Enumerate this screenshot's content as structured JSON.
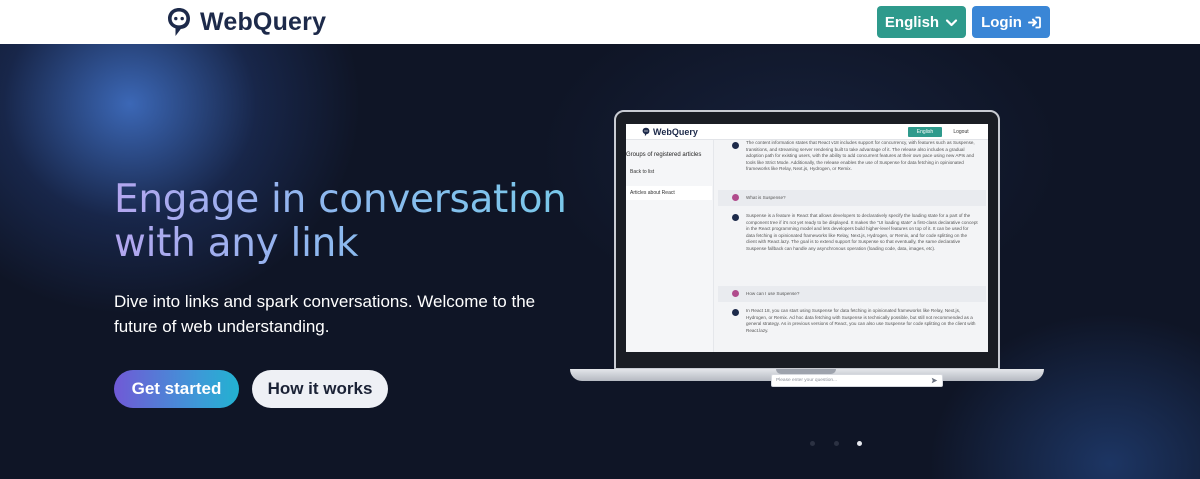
{
  "header": {
    "brand_name": "WebQuery",
    "language_label": "English",
    "login_label": "Login"
  },
  "hero": {
    "title_line1": "Engage in conversation",
    "title_line2": "with any link",
    "subtitle": "Dive into links and spark conversations. Welcome to the future of web understanding.",
    "cta_label": "Get started",
    "secondary_label": "How it works"
  },
  "screen": {
    "brand_name": "WebQuery",
    "language_label": "English",
    "logout_label": "Logout",
    "sidebar_title": "Groups of registered articles",
    "back_link": "Back to list",
    "selected_group": "Articles about React",
    "input_placeholder": "Please enter your question...",
    "messages": [
      {
        "role": "bot",
        "text": "The content information states that React v18 includes support for concurrency, with features such as Suspense, transitions, and streaming server rendering built to take advantage of it. The release also includes a gradual adoption path for existing users, with the ability to add concurrent features at their own pace using new APIs and tools like Strict Mode. Additionally, the release enables the use of Suspense for data fetching in opinionated frameworks like Relay, Next.js, Hydrogen, or Remix."
      },
      {
        "role": "user",
        "text": "What is Suspense?"
      },
      {
        "role": "bot",
        "text": "Suspense is a feature in React that allows developers to declaratively specify the loading state for a part of the component tree if it's not yet ready to be displayed. It makes the \"UI loading state\" a first-class declarative concept in the React programming model and lets developers build higher-level features on top of it. It can be used for data fetching in opinionated frameworks like Relay, Next.js, Hydrogen, or Remix, and for code splitting on the client with React.lazy. The goal is to extend support for Suspense so that eventually, the same declarative Suspense fallback can handle any asynchronous operation (loading code, data, images, etc)."
      },
      {
        "role": "user",
        "text": "How can I use Suspense?"
      },
      {
        "role": "bot",
        "text": "In React 18, you can start using Suspense for data fetching in opinionated frameworks like Relay, Next.js, Hydrogen, or Remix. Ad hoc data fetching with Suspense is technically possible, but still not recommended as a general strategy. As in previous versions of React, you can also use Suspense for code splitting on the client with React.lazy."
      }
    ]
  },
  "carousel": {
    "total": 3,
    "active_index": 2
  },
  "colors": {
    "language_button": "#2e9a8c",
    "login_button": "#3a86d6",
    "brand_text": "#1d2a4a"
  }
}
